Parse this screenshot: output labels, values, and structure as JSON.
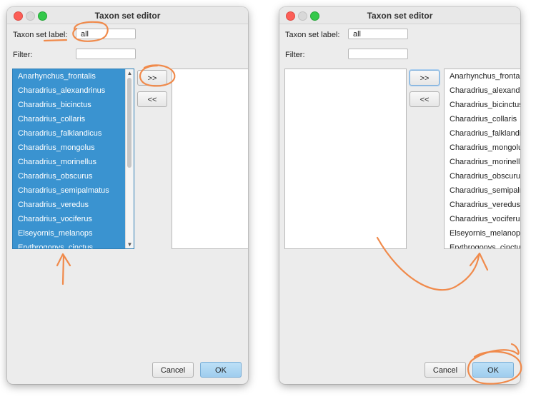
{
  "window": {
    "title": "Taxon set editor"
  },
  "labels": {
    "taxon_set_label": "Taxon set label:",
    "filter": "Filter:"
  },
  "fields": {
    "taxon_set_value": "all",
    "filter_value": ""
  },
  "buttons": {
    "add": ">>",
    "remove": "<<",
    "cancel": "Cancel",
    "ok": "OK"
  },
  "taxa": [
    "Anarhynchus_frontalis",
    "Charadrius_alexandrinus",
    "Charadrius_bicinctus",
    "Charadrius_collaris",
    "Charadrius_falklandicus",
    "Charadrius_mongolus",
    "Charadrius_morinellus",
    "Charadrius_obscurus",
    "Charadrius_semipalmatus",
    "Charadrius_veredus",
    "Charadrius_vociferus",
    "Elseyornis_melanops",
    "Erythrogonys_cinctus"
  ],
  "colors": {
    "selection": "#3a93d0",
    "annotation": "#f08a4b",
    "ok_button": "#a9d4f1"
  }
}
